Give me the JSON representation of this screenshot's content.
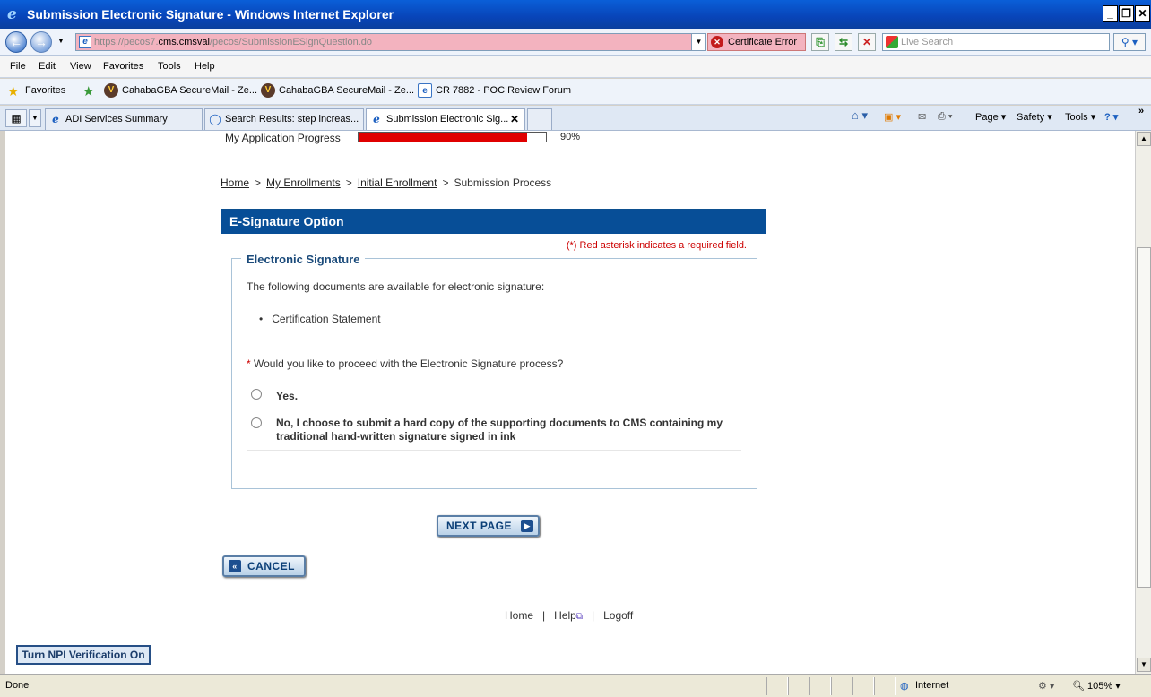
{
  "window": {
    "title": "Submission Electronic Signature - Windows Internet Explorer"
  },
  "address": {
    "url_prefix": "https://pecos7.",
    "url_domain": "cms.cmsval",
    "url_path": "/pecos/SubmissionESignQuestion.do",
    "cert_error": "Certificate Error",
    "search_placeholder": "Live Search"
  },
  "menu": [
    "File",
    "Edit",
    "View",
    "Favorites",
    "Tools",
    "Help"
  ],
  "favorites": {
    "label": "Favorites",
    "items": [
      "CahabaGBA SecureMail - Ze...",
      "CahabaGBA SecureMail - Ze...",
      "CR 7882 - POC Review Forum"
    ]
  },
  "tabs": [
    {
      "label": "ADI Services Summary"
    },
    {
      "label": "Search Results: step increas..."
    },
    {
      "label": "Submission Electronic Sig..."
    }
  ],
  "commands": {
    "page": "Page",
    "safety": "Safety",
    "tools": "Tools"
  },
  "progress": {
    "label": "My Application Progress",
    "percent_text": "90%",
    "value": 0.9,
    "color": "#e00000"
  },
  "breadcrumb": {
    "home": "Home",
    "enrollments": "My Enrollments",
    "initial": "Initial Enrollment",
    "current": "Submission Process",
    "sep": ">"
  },
  "panel": {
    "title": "E-Signature Option",
    "required_note": "(*) Red asterisk indicates a required field.",
    "section_title": "Electronic Signature",
    "intro": "The following documents are available for electronic signature:",
    "documents": [
      "Certification Statement"
    ],
    "question": "Would you like to proceed with the Electronic Signature process?",
    "asterisk": "*",
    "options": [
      {
        "line1": "Yes.",
        "line2": ""
      },
      {
        "line1": "No, I choose to submit a hard copy of the supporting documents to CMS containing my",
        "line2": "traditional hand-written signature signed in ink"
      }
    ],
    "next_button": "NEXT PAGE"
  },
  "cancel_button": "CANCEL",
  "footer": {
    "home": "Home",
    "help": "Help",
    "logoff": "Logoff"
  },
  "npi_button": "Turn NPI Verification On",
  "status": {
    "text": "Done",
    "zone": "Internet",
    "zoom": "105%"
  },
  "colors": {
    "panel_header": "#074e97",
    "title_bar": "#0844b8",
    "required": "#cc0000"
  }
}
